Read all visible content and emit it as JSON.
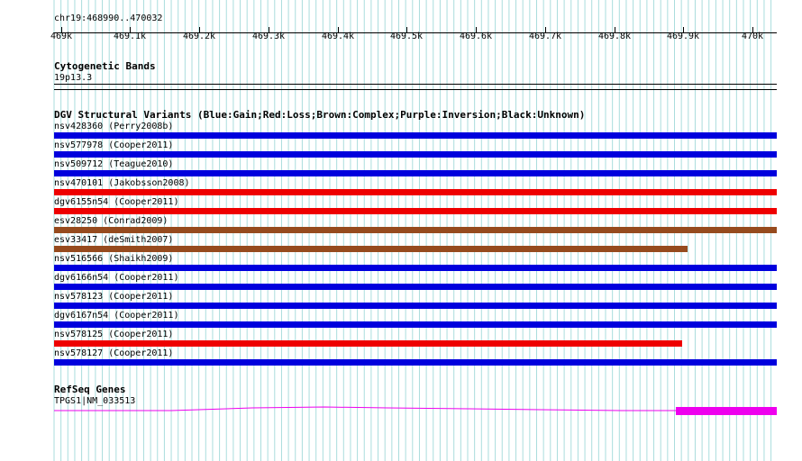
{
  "ruler": {
    "location": "chr19:468990..470032",
    "ticks": [
      "469k",
      "469.1k",
      "469.2k",
      "469.3k",
      "469.4k",
      "469.5k",
      "469.6k",
      "469.7k",
      "469.8k",
      "469.9k",
      "470k"
    ]
  },
  "cytoband": {
    "title": "Cytogenetic Bands",
    "band": "19p13.3"
  },
  "dgv": {
    "title": "DGV Structural Variants (Blue:Gain;Red:Loss;Brown:Complex;Purple:Inversion;Black:Unknown)",
    "variants": [
      {
        "label": "nsv428360 (Perry2008b)",
        "type": "gain",
        "color": "#0000dd",
        "end_fraction": 1.0
      },
      {
        "label": "nsv577978 (Cooper2011)",
        "type": "gain",
        "color": "#0000dd",
        "end_fraction": 1.0
      },
      {
        "label": "nsv509712 (Teague2010)",
        "type": "gain",
        "color": "#0000dd",
        "end_fraction": 1.0
      },
      {
        "label": "nsv470101 (Jakobsson2008)",
        "type": "loss",
        "color": "#ee0000",
        "end_fraction": 1.0
      },
      {
        "label": "dgv6155n54 (Cooper2011)",
        "type": "loss",
        "color": "#ee0000",
        "end_fraction": 1.0
      },
      {
        "label": "esv28250 (Conrad2009)",
        "type": "complex",
        "color": "#964b1e",
        "end_fraction": 1.0
      },
      {
        "label": "esv33417 (deSmith2007)",
        "type": "complex",
        "color": "#964b1e",
        "end_fraction": 0.877
      },
      {
        "label": "nsv516566 (Shaikh2009)",
        "type": "gain",
        "color": "#0000dd",
        "end_fraction": 1.0
      },
      {
        "label": "dgv6166n54 (Cooper2011)",
        "type": "gain",
        "color": "#0000dd",
        "end_fraction": 1.0
      },
      {
        "label": "nsv578123 (Cooper2011)",
        "type": "gain",
        "color": "#0000dd",
        "end_fraction": 1.0
      },
      {
        "label": "dgv6167n54 (Cooper2011)",
        "type": "gain",
        "color": "#0000dd",
        "end_fraction": 1.0
      },
      {
        "label": "nsv578125 (Cooper2011)",
        "type": "loss",
        "color": "#ee0000",
        "end_fraction": 0.869
      },
      {
        "label": "nsv578127 (Cooper2011)",
        "type": "gain",
        "color": "#0000dd",
        "end_fraction": 1.0
      }
    ]
  },
  "refseq": {
    "title": "RefSeq Genes",
    "gene_label": "TPGS1|NM_033513",
    "color": "#ee00ee"
  },
  "grid_color": "#aadddd"
}
